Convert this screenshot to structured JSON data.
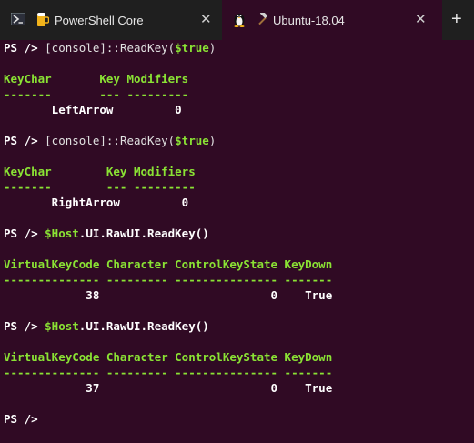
{
  "tabs": [
    {
      "title": "PowerShell Core",
      "icon": "powershell-icon"
    },
    {
      "title": "Ubuntu-18.04",
      "icon": "hammer-icon",
      "extra_icon": "tux-icon"
    }
  ],
  "close_glyph": "✕",
  "new_tab_glyph": "+",
  "terminal": {
    "lines": [
      [
        {
          "t": "PS /> ",
          "c": "w"
        },
        {
          "t": "[console]::ReadKey(",
          "c": "n"
        },
        {
          "t": "$true",
          "c": "g"
        },
        {
          "t": ")",
          "c": "n"
        }
      ],
      [],
      [
        {
          "t": "KeyChar       Key Modifiers",
          "c": "g"
        }
      ],
      [
        {
          "t": "-------       --- ---------",
          "c": "g"
        }
      ],
      [
        {
          "t": "       LeftArrow         0",
          "c": "w"
        }
      ],
      [],
      [
        {
          "t": "PS /> ",
          "c": "w"
        },
        {
          "t": "[console]::ReadKey(",
          "c": "n"
        },
        {
          "t": "$true",
          "c": "g"
        },
        {
          "t": ")",
          "c": "n"
        }
      ],
      [],
      [
        {
          "t": "KeyChar        Key Modifiers",
          "c": "g"
        }
      ],
      [
        {
          "t": "-------        --- ---------",
          "c": "g"
        }
      ],
      [
        {
          "t": "       RightArrow         0",
          "c": "w"
        }
      ],
      [],
      [
        {
          "t": "PS /> ",
          "c": "w"
        },
        {
          "t": "$Host",
          "c": "g"
        },
        {
          "t": ".UI.RawUI.ReadKey()",
          "c": "w"
        }
      ],
      [],
      [
        {
          "t": "VirtualKeyCode Character ControlKeyState KeyDown",
          "c": "g"
        }
      ],
      [
        {
          "t": "-------------- --------- --------------- -------",
          "c": "g"
        }
      ],
      [
        {
          "t": "            38                         0    True",
          "c": "w"
        }
      ],
      [],
      [
        {
          "t": "PS /> ",
          "c": "w"
        },
        {
          "t": "$Host",
          "c": "g"
        },
        {
          "t": ".UI.RawUI.ReadKey()",
          "c": "w"
        }
      ],
      [],
      [
        {
          "t": "VirtualKeyCode Character ControlKeyState KeyDown",
          "c": "g"
        }
      ],
      [
        {
          "t": "-------------- --------- --------------- -------",
          "c": "g"
        }
      ],
      [
        {
          "t": "            37                         0    True",
          "c": "w"
        }
      ],
      [],
      [
        {
          "t": "PS /> ",
          "c": "w"
        }
      ]
    ]
  }
}
